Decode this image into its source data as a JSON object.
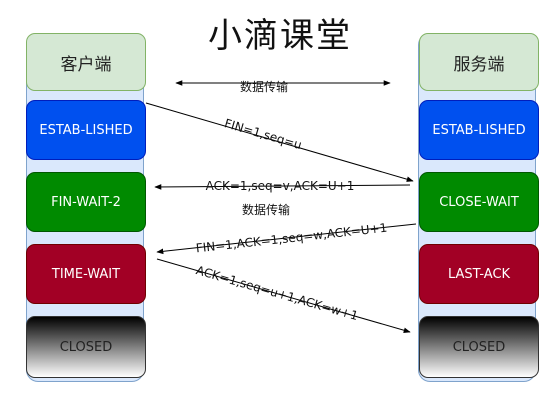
{
  "title": "小滴课堂",
  "client": {
    "header": "客户端",
    "states": [
      "ESTAB-LISHED",
      "FIN-WAIT-2",
      "TIME-WAIT",
      "CLOSED"
    ]
  },
  "server": {
    "header": "服务端",
    "states": [
      "ESTAB-LISHED",
      "CLOSE-WAIT",
      "LAST-ACK",
      "CLOSED"
    ]
  },
  "messages": {
    "data_transfer_top": "数据传输",
    "fin1": "FIN=1,seq=u",
    "ack1": "ACK=1,seq=v,ACK=U+1",
    "data_transfer_mid": "数据传输",
    "fin2": "FIN=1,ACK=1,seq=w,ACK=U+1",
    "ack2": "ACK=1,seq=u+1,ACK=w+1"
  },
  "colors": {
    "header_fill": "#d5e8d4",
    "established": "#0050ef",
    "wait": "#008a00",
    "time_wait": "#a20025",
    "column_bg": "#dae8fc"
  }
}
